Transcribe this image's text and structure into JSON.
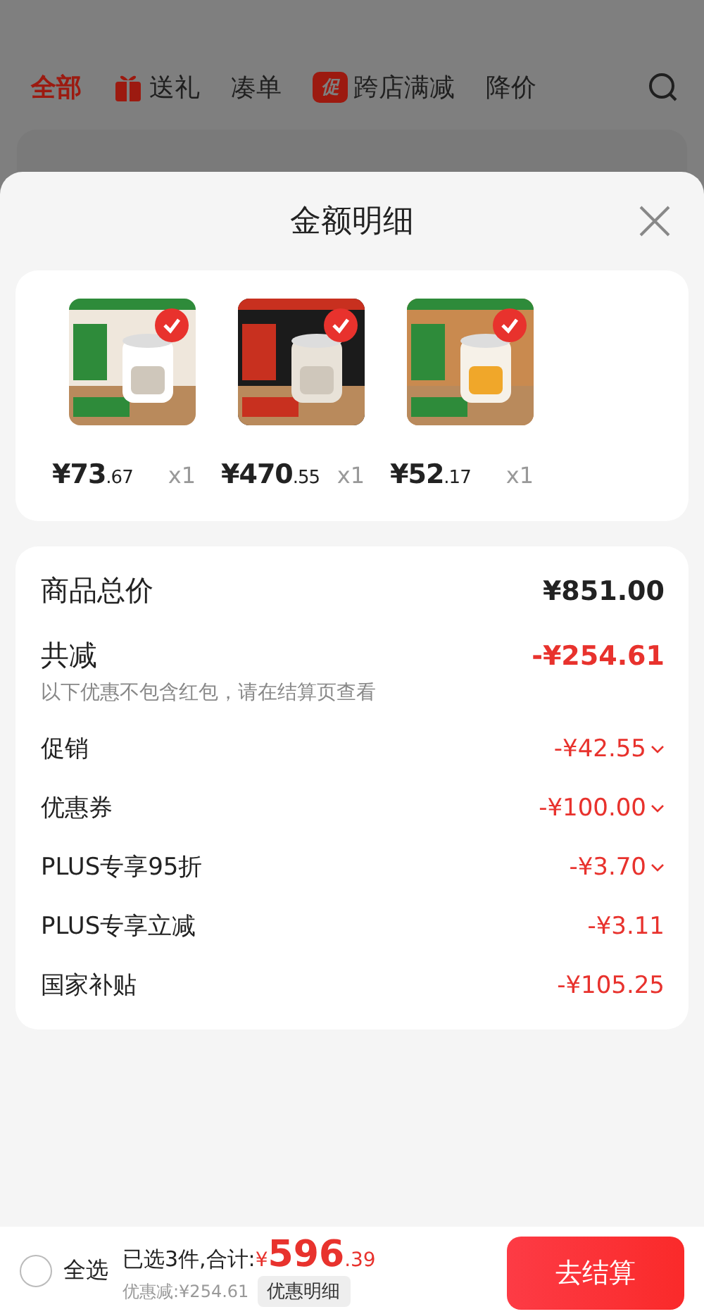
{
  "background_tabs": [
    {
      "label": "全部",
      "selected": true,
      "kind": "text"
    },
    {
      "label": "送礼",
      "selected": false,
      "kind": "gift"
    },
    {
      "label": "凑单",
      "selected": false,
      "kind": "text"
    },
    {
      "label": "跨店满减",
      "selected": false,
      "kind": "promo",
      "badge": "促"
    },
    {
      "label": "降价",
      "selected": false,
      "kind": "text"
    }
  ],
  "sheet": {
    "title": "金额明细",
    "products": [
      {
        "price_main": "¥73",
        "price_cents": ".67",
        "quantity": "x1",
        "checked": true
      },
      {
        "price_main": "¥470",
        "price_cents": ".55",
        "quantity": "x1",
        "checked": true
      },
      {
        "price_main": "¥52",
        "price_cents": ".17",
        "quantity": "x1",
        "checked": true
      }
    ],
    "summary": [
      {
        "kind": "total",
        "label": "商品总价",
        "amount": "¥851.00"
      },
      {
        "kind": "reduction",
        "label": "共减",
        "amount": "-¥254.61",
        "note": "以下优惠不包含红包，请在结算页查看"
      },
      {
        "kind": "item",
        "label": "促销",
        "amount": "-¥42.55",
        "expandable": true
      },
      {
        "kind": "item",
        "label": "优惠券",
        "amount": "-¥100.00",
        "expandable": true
      },
      {
        "kind": "item",
        "label": "PLUS专享95折",
        "amount": "-¥3.70",
        "expandable": true
      },
      {
        "kind": "item",
        "label": "PLUS专享立减",
        "amount": "-¥3.11",
        "expandable": false
      },
      {
        "kind": "item",
        "label": "国家补贴",
        "amount": "-¥105.25",
        "expandable": false
      }
    ]
  },
  "bottom_bar": {
    "select_all": {
      "label": "全选",
      "checked": false
    },
    "selected_text": "已选3件,合计:",
    "currency": "¥",
    "total_main": "596",
    "total_cents": ".39",
    "discount_text": "优惠减:¥254.61",
    "details_button": "优惠明细",
    "checkout_button": "去结算"
  }
}
